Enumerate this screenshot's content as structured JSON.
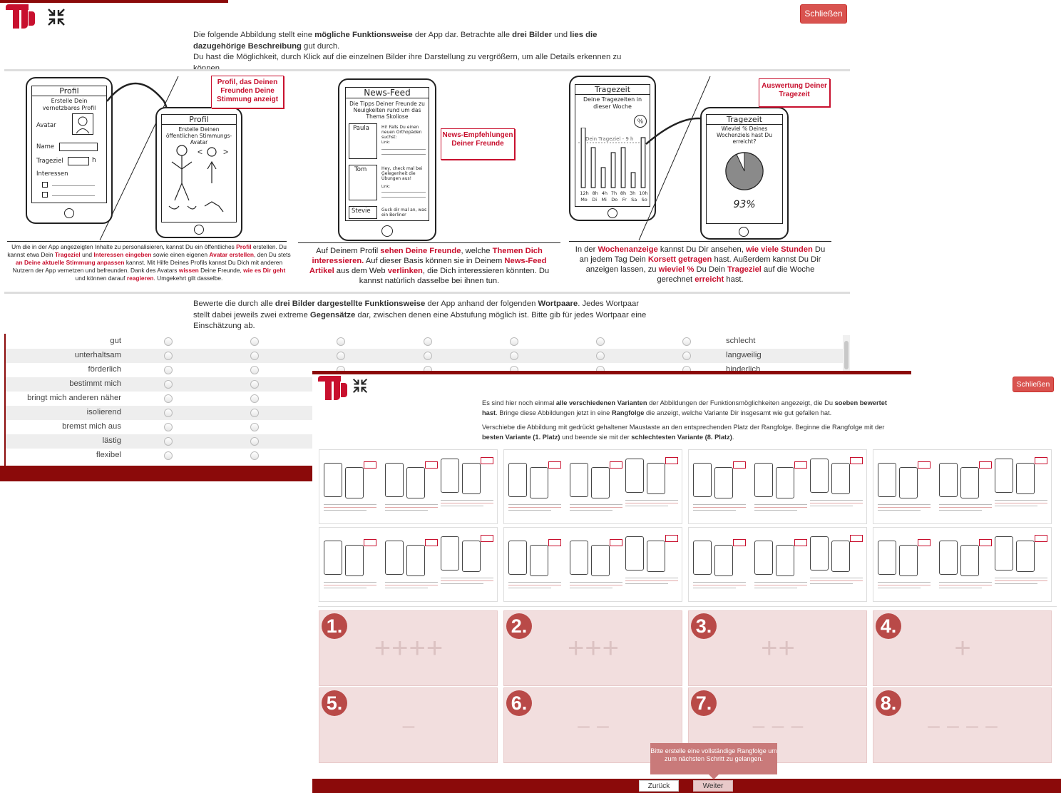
{
  "back": {
    "close_label": "Schließen",
    "intro": {
      "p1_a": "Die folgende Abbildung stellt eine ",
      "p1_b": "mögliche Funktionsweise",
      "p1_c": " der App dar. Betrachte alle ",
      "p1_d": "drei Bilder",
      "p1_e": " und ",
      "p1_f": "lies die dazugehörige Beschreibung",
      "p1_g": " gut durch.",
      "p2": "Du hast die Möglichkeit, durch Klick auf die einzelnen Bilder ihre Darstellung zu vergrößern, um alle Details erkennen zu können."
    },
    "panels": [
      {
        "phone1_title": "Profil",
        "phone1_sub": "Erstelle Dein vernetzbares Profil",
        "field_avatar": "Avatar",
        "field_name": "Name",
        "field_trageziel": "Trageziel",
        "field_unit": "h",
        "field_interessen": "Interessen",
        "phone2_title": "Profil",
        "phone2_sub": "Erstelle Deinen öffentlichen Stimmungs-Avatar",
        "bubble": "Profil, das Deinen Freunden Deine Stimmung anzeigt",
        "caption": [
          {
            "t": "Um die in der App angezeigten Inhalte zu personalisieren, kannst Du ein öffentliches ",
            "r": false
          },
          {
            "t": "Profil",
            "r": true
          },
          {
            "t": " erstellen. Du kannst etwa Dein ",
            "r": false
          },
          {
            "t": "Trageziel",
            "r": true
          },
          {
            "t": " und ",
            "r": false
          },
          {
            "t": "Interessen eingeben",
            "r": true
          },
          {
            "t": " sowie einen eigenen ",
            "r": false
          },
          {
            "t": "Avatar erstellen",
            "r": true
          },
          {
            "t": ", den Du stets ",
            "r": false
          },
          {
            "t": "an Deine aktuelle Stimmung anpassen",
            "r": true
          },
          {
            "t": " kannst. Mit Hilfe Deines Profils kannst Du Dich mit anderen Nutzern der App vernetzen und befreunden. Dank des Avatars ",
            "r": false
          },
          {
            "t": "wissen",
            "r": true
          },
          {
            "t": " Deine Freunde, ",
            "r": false
          },
          {
            "t": "wie es Dir geht",
            "r": true
          },
          {
            "t": " und können darauf ",
            "r": false
          },
          {
            "t": "reagieren",
            "r": true
          },
          {
            "t": ". Umgekehrt gilt dasselbe.",
            "r": false
          }
        ]
      },
      {
        "phone_title": "News-Feed",
        "phone_sub": "Die Tipps Deiner Freunde zu Neuigkeiten rund um das Thema Skoliose",
        "names": [
          "Paula",
          "Tom",
          "Stevie"
        ],
        "posts": [
          "Hi! Falls Du einen neuen Orthopäden suchst:",
          "Hey, check mal bei Gelegenheit die Übungen aus!",
          "Guck dir mal an, was ein Berliner"
        ],
        "link_label": "Link:",
        "bubble": "News-Empfehlungen Deiner Freunde",
        "caption": [
          {
            "t": "Auf Deinem Profil ",
            "r": false
          },
          {
            "t": "sehen Deine Freunde",
            "r": true
          },
          {
            "t": ", welche ",
            "r": false
          },
          {
            "t": "Themen Dich interessieren.",
            "r": true
          },
          {
            "t": " Auf dieser Basis können sie in Deinem ",
            "r": false
          },
          {
            "t": "News-Feed Artikel",
            "r": true
          },
          {
            "t": " aus dem Web ",
            "r": false
          },
          {
            "t": "verlinken",
            "r": true
          },
          {
            "t": ", die Dich interessieren könnten. Du kannst natürlich dasselbe bei ihnen tun.",
            "r": false
          }
        ]
      },
      {
        "phone1_title": "Tragezeit",
        "phone1_sub": "Deine Tragezeiten in dieser Woche",
        "goal_label": "Dein Trageziel - 9 h",
        "hours": [
          "12h",
          "8h",
          "4h",
          "7h",
          "8h",
          "3h",
          "10h"
        ],
        "days": [
          "Mo",
          "Di",
          "Mi",
          "Do",
          "Fr",
          "Sa",
          "So"
        ],
        "percent_symbol": "%",
        "phone2_title": "Tragezeit",
        "phone2_sub": "Wieviel % Deines Wochenziels hast Du erreicht?",
        "percent_value": "93%",
        "percent_fraction": 0.93,
        "bubble": "Auswertung Deiner Tragezeit",
        "caption": [
          {
            "t": "In der ",
            "r": false
          },
          {
            "t": "Wochenanzeige",
            "r": true
          },
          {
            "t": " kannst Du Dir ansehen, ",
            "r": false
          },
          {
            "t": "wie viele Stunden",
            "r": true
          },
          {
            "t": " Du an jedem Tag Dein ",
            "r": false
          },
          {
            "t": "Korsett getragen",
            "r": true
          },
          {
            "t": " hast. Außerdem kannst Du Dir anzeigen lassen, zu ",
            "r": false
          },
          {
            "t": "wieviel %",
            "r": true
          },
          {
            "t": " Du Dein ",
            "r": false
          },
          {
            "t": "Trageziel",
            "r": true
          },
          {
            "t": " auf die Woche gerechnet ",
            "r": false
          },
          {
            "t": "erreicht",
            "r": true
          },
          {
            "t": " hast.",
            "r": false
          }
        ]
      }
    ],
    "question": {
      "a": "Bewerte die durch alle ",
      "b": "drei Bilder dargestellte Funktionsweise",
      "c": " der App anhand der folgenden ",
      "d": "Wortpaare",
      "e": ". Jedes Wortpaar stellt dabei jeweils zwei extreme ",
      "f": "Gegensätze",
      "g": " dar, zwischen denen eine Abstufung möglich ist. Bitte gib für jedes Wortpaar eine Einschätzung ab."
    },
    "word_pairs": [
      {
        "left": "gut",
        "right": "schlecht"
      },
      {
        "left": "unterhaltsam",
        "right": "langweilig"
      },
      {
        "left": "förderlich",
        "right": "hinderlich"
      },
      {
        "left": "bestimmt mich",
        "right": ""
      },
      {
        "left": "bringt mich anderen näher",
        "right": ""
      },
      {
        "left": "isolierend",
        "right": ""
      },
      {
        "left": "bremst mich aus",
        "right": ""
      },
      {
        "left": "lästig",
        "right": ""
      },
      {
        "left": "flexibel",
        "right": ""
      }
    ]
  },
  "front": {
    "close_label": "Schließen",
    "p1_a": "Es sind hier noch einmal ",
    "p1_b": "alle verschiedenen Varianten",
    "p1_c": " der Abbildungen der Funktionsmöglichkeiten angezeigt, die Du ",
    "p1_d": "soeben bewertet hast",
    "p1_e": ". Bringe diese Abbildungen jetzt in eine ",
    "p1_f": "Rangfolge",
    "p1_g": " die anzeigt, welche Variante Dir insgesamt wie gut gefallen hat.",
    "p2_a": "Verschiebe die Abbildung mit gedrückt gehaltener Maustaste an den entsprechenden Platz der Rangfolge. Beginne die Rangfolge mit der ",
    "p2_b": "besten Variante (1. Platz)",
    "p2_c": " und beende sie mit der ",
    "p2_d": "schlechtesten Variante (8. Platz)",
    "p2_e": ".",
    "slots": [
      {
        "num": "1.",
        "sym": "++++"
      },
      {
        "num": "2.",
        "sym": "+++"
      },
      {
        "num": "3.",
        "sym": "++"
      },
      {
        "num": "4.",
        "sym": "+"
      },
      {
        "num": "5.",
        "sym": "–"
      },
      {
        "num": "6.",
        "sym": "– –"
      },
      {
        "num": "7.",
        "sym": "– – –"
      },
      {
        "num": "8.",
        "sym": "– – – –"
      }
    ],
    "tooltip": "Bitte erstelle eine vollständige Rangfolge um zum nächsten Schritt zu gelangen.",
    "back_label": "Zurück",
    "next_label": "Weiter"
  },
  "colors": {
    "brand_red": "#c8102e",
    "dark_red": "#8b0a0a",
    "close_btn": "#d9534f",
    "slot_bg": "#f2dede",
    "slot_num": "#b94a48"
  }
}
